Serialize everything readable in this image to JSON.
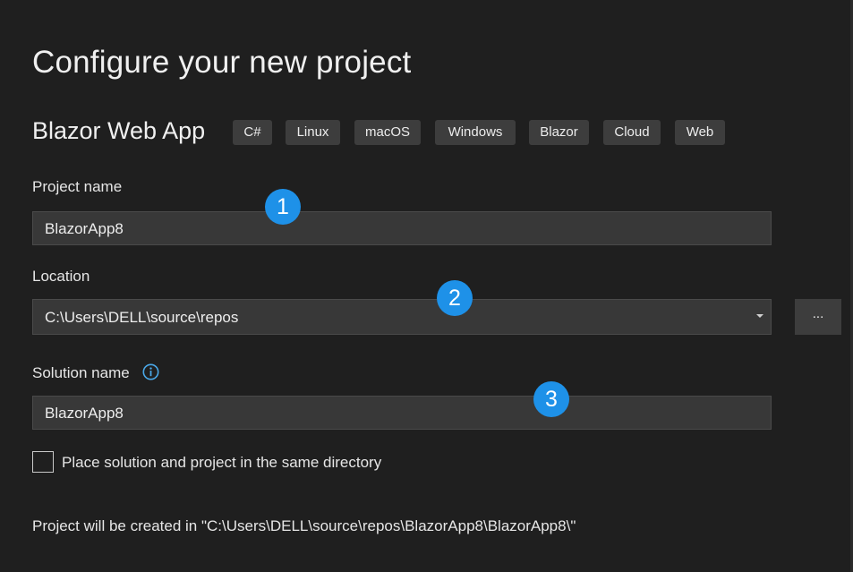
{
  "page": {
    "title": "Configure your new project"
  },
  "template": {
    "name": "Blazor Web App",
    "tags": [
      "C#",
      "Linux",
      "macOS",
      "Windows",
      "Blazor",
      "Cloud",
      "Web"
    ]
  },
  "project_name": {
    "label": "Project name",
    "value": "BlazorApp8"
  },
  "location": {
    "label": "Location",
    "value": "C:\\Users\\DELL\\source\\repos",
    "browse_label": "..."
  },
  "solution_name": {
    "label": "Solution name",
    "value": "BlazorApp8",
    "icon": "info-icon"
  },
  "same_directory": {
    "label": "Place solution and project in the same directory",
    "checked": false
  },
  "footer": {
    "path_text": "Project will be created in \"C:\\Users\\DELL\\source\\repos\\BlazorApp8\\BlazorApp8\\\""
  },
  "badges": [
    "1",
    "2",
    "3"
  ],
  "colors": {
    "background": "#1f1f1f",
    "field": "#383838",
    "tag": "#3d3d3d",
    "badge": "#1e91e8",
    "info_icon": "#4aa8e8"
  }
}
